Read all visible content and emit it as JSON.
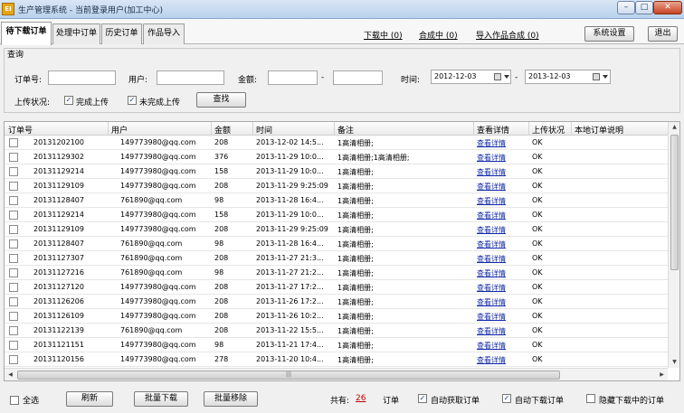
{
  "window": {
    "title": "生产管理系统 - 当前登录用户(加工中心)",
    "icon_text": "EI",
    "min": "–",
    "max": "□",
    "close": "✕"
  },
  "tabs": [
    "待下载订单",
    "处理中订单",
    "历史订单",
    "作品导入"
  ],
  "top_links": {
    "downloading": "下载中 (0)",
    "compositing": "合成中 (0)",
    "import_compose": "导入作品合成 (0)"
  },
  "top_buttons": {
    "settings": "系统设置",
    "exit": "退出"
  },
  "query": {
    "legend": "查询",
    "order_no_label": "订单号:",
    "order_no_value": "",
    "user_label": "用户:",
    "user_value": "",
    "amount_label": "金额:",
    "amount_from": "",
    "amount_sep": "-",
    "amount_to": "",
    "time_label": "时间:",
    "date_from": "2012-12-03",
    "date_sep": "-",
    "date_to": "2013-12-03",
    "upload_status_label": "上传状况:",
    "upload_complete_label": "完成上传",
    "upload_incomplete_label": "未完成上传",
    "search_button": "查找"
  },
  "table": {
    "columns": [
      "订单号",
      "用户",
      "金额",
      "时间",
      "备注",
      "查看详情",
      "上传状况",
      "本地订单说明"
    ],
    "rows": [
      {
        "order": "20131202100",
        "user": "149773980@qq.com",
        "amount": "208",
        "time": "2013-12-02 14:5...",
        "note": "1高清相册;",
        "detail": "查看详情",
        "status": "OK",
        "local": ""
      },
      {
        "order": "20131129302",
        "user": "149773980@qq.com",
        "amount": "376",
        "time": "2013-11-29 10:0...",
        "note": "1高清相册;1高清相册;",
        "detail": "查看详情",
        "status": "OK",
        "local": ""
      },
      {
        "order": "20131129214",
        "user": "149773980@qq.com",
        "amount": "158",
        "time": "2013-11-29 10:0...",
        "note": "1高清相册;",
        "detail": "查看详情",
        "status": "OK",
        "local": ""
      },
      {
        "order": "20131129109",
        "user": "149773980@qq.com",
        "amount": "208",
        "time": "2013-11-29 9:25:09",
        "note": "1高清相册;",
        "detail": "查看详情",
        "status": "OK",
        "local": ""
      },
      {
        "order": "20131128407",
        "user": "761890@qq.com",
        "amount": "98",
        "time": "2013-11-28 16:4...",
        "note": "1高清相册;",
        "detail": "查看详情",
        "status": "OK",
        "local": ""
      },
      {
        "order": "20131129214",
        "user": "149773980@qq.com",
        "amount": "158",
        "time": "2013-11-29 10:0...",
        "note": "1高清相册;",
        "detail": "查看详情",
        "status": "OK",
        "local": ""
      },
      {
        "order": "20131129109",
        "user": "149773980@qq.com",
        "amount": "208",
        "time": "2013-11-29 9:25:09",
        "note": "1高清相册;",
        "detail": "查看详情",
        "status": "OK",
        "local": ""
      },
      {
        "order": "20131128407",
        "user": "761890@qq.com",
        "amount": "98",
        "time": "2013-11-28 16:4...",
        "note": "1高清相册;",
        "detail": "查看详情",
        "status": "OK",
        "local": ""
      },
      {
        "order": "20131127307",
        "user": "761890@qq.com",
        "amount": "208",
        "time": "2013-11-27 21:3...",
        "note": "1高清相册;",
        "detail": "查看详情",
        "status": "OK",
        "local": ""
      },
      {
        "order": "20131127216",
        "user": "761890@qq.com",
        "amount": "98",
        "time": "2013-11-27 21:2...",
        "note": "1高清相册;",
        "detail": "查看详情",
        "status": "OK",
        "local": ""
      },
      {
        "order": "20131127120",
        "user": "149773980@qq.com",
        "amount": "208",
        "time": "2013-11-27 17:2...",
        "note": "1高清相册;",
        "detail": "查看详情",
        "status": "OK",
        "local": ""
      },
      {
        "order": "20131126206",
        "user": "149773980@qq.com",
        "amount": "208",
        "time": "2013-11-26 17:2...",
        "note": "1高清相册;",
        "detail": "查看详情",
        "status": "OK",
        "local": ""
      },
      {
        "order": "20131126109",
        "user": "149773980@qq.com",
        "amount": "208",
        "time": "2013-11-26 10:2...",
        "note": "1高清相册;",
        "detail": "查看详情",
        "status": "OK",
        "local": ""
      },
      {
        "order": "20131122139",
        "user": "761890@qq.com",
        "amount": "208",
        "time": "2013-11-22 15:5...",
        "note": "1高清相册;",
        "detail": "查看详情",
        "status": "OK",
        "local": ""
      },
      {
        "order": "20131121151",
        "user": "149773980@qq.com",
        "amount": "98",
        "time": "2013-11-21 17:4...",
        "note": "1高清相册;",
        "detail": "查看详情",
        "status": "OK",
        "local": ""
      },
      {
        "order": "20131120156",
        "user": "149773980@qq.com",
        "amount": "278",
        "time": "2013-11-20 10:4...",
        "note": "1高清相册;",
        "detail": "查看详情",
        "status": "OK",
        "local": ""
      }
    ]
  },
  "footer": {
    "select_all": "全选",
    "refresh": "刷新",
    "batch_download": "批量下载",
    "batch_remove": "批量移除",
    "total_label": "共有:",
    "total_count": "26",
    "total_unit": "订单",
    "auto_fetch": "自动获取订单",
    "auto_download": "自动下载订单",
    "hide_downloading": "隐藏下载中的订单"
  },
  "colors": {
    "link": "#1028a8",
    "count": "#c00000",
    "close_button": "#c74322"
  }
}
